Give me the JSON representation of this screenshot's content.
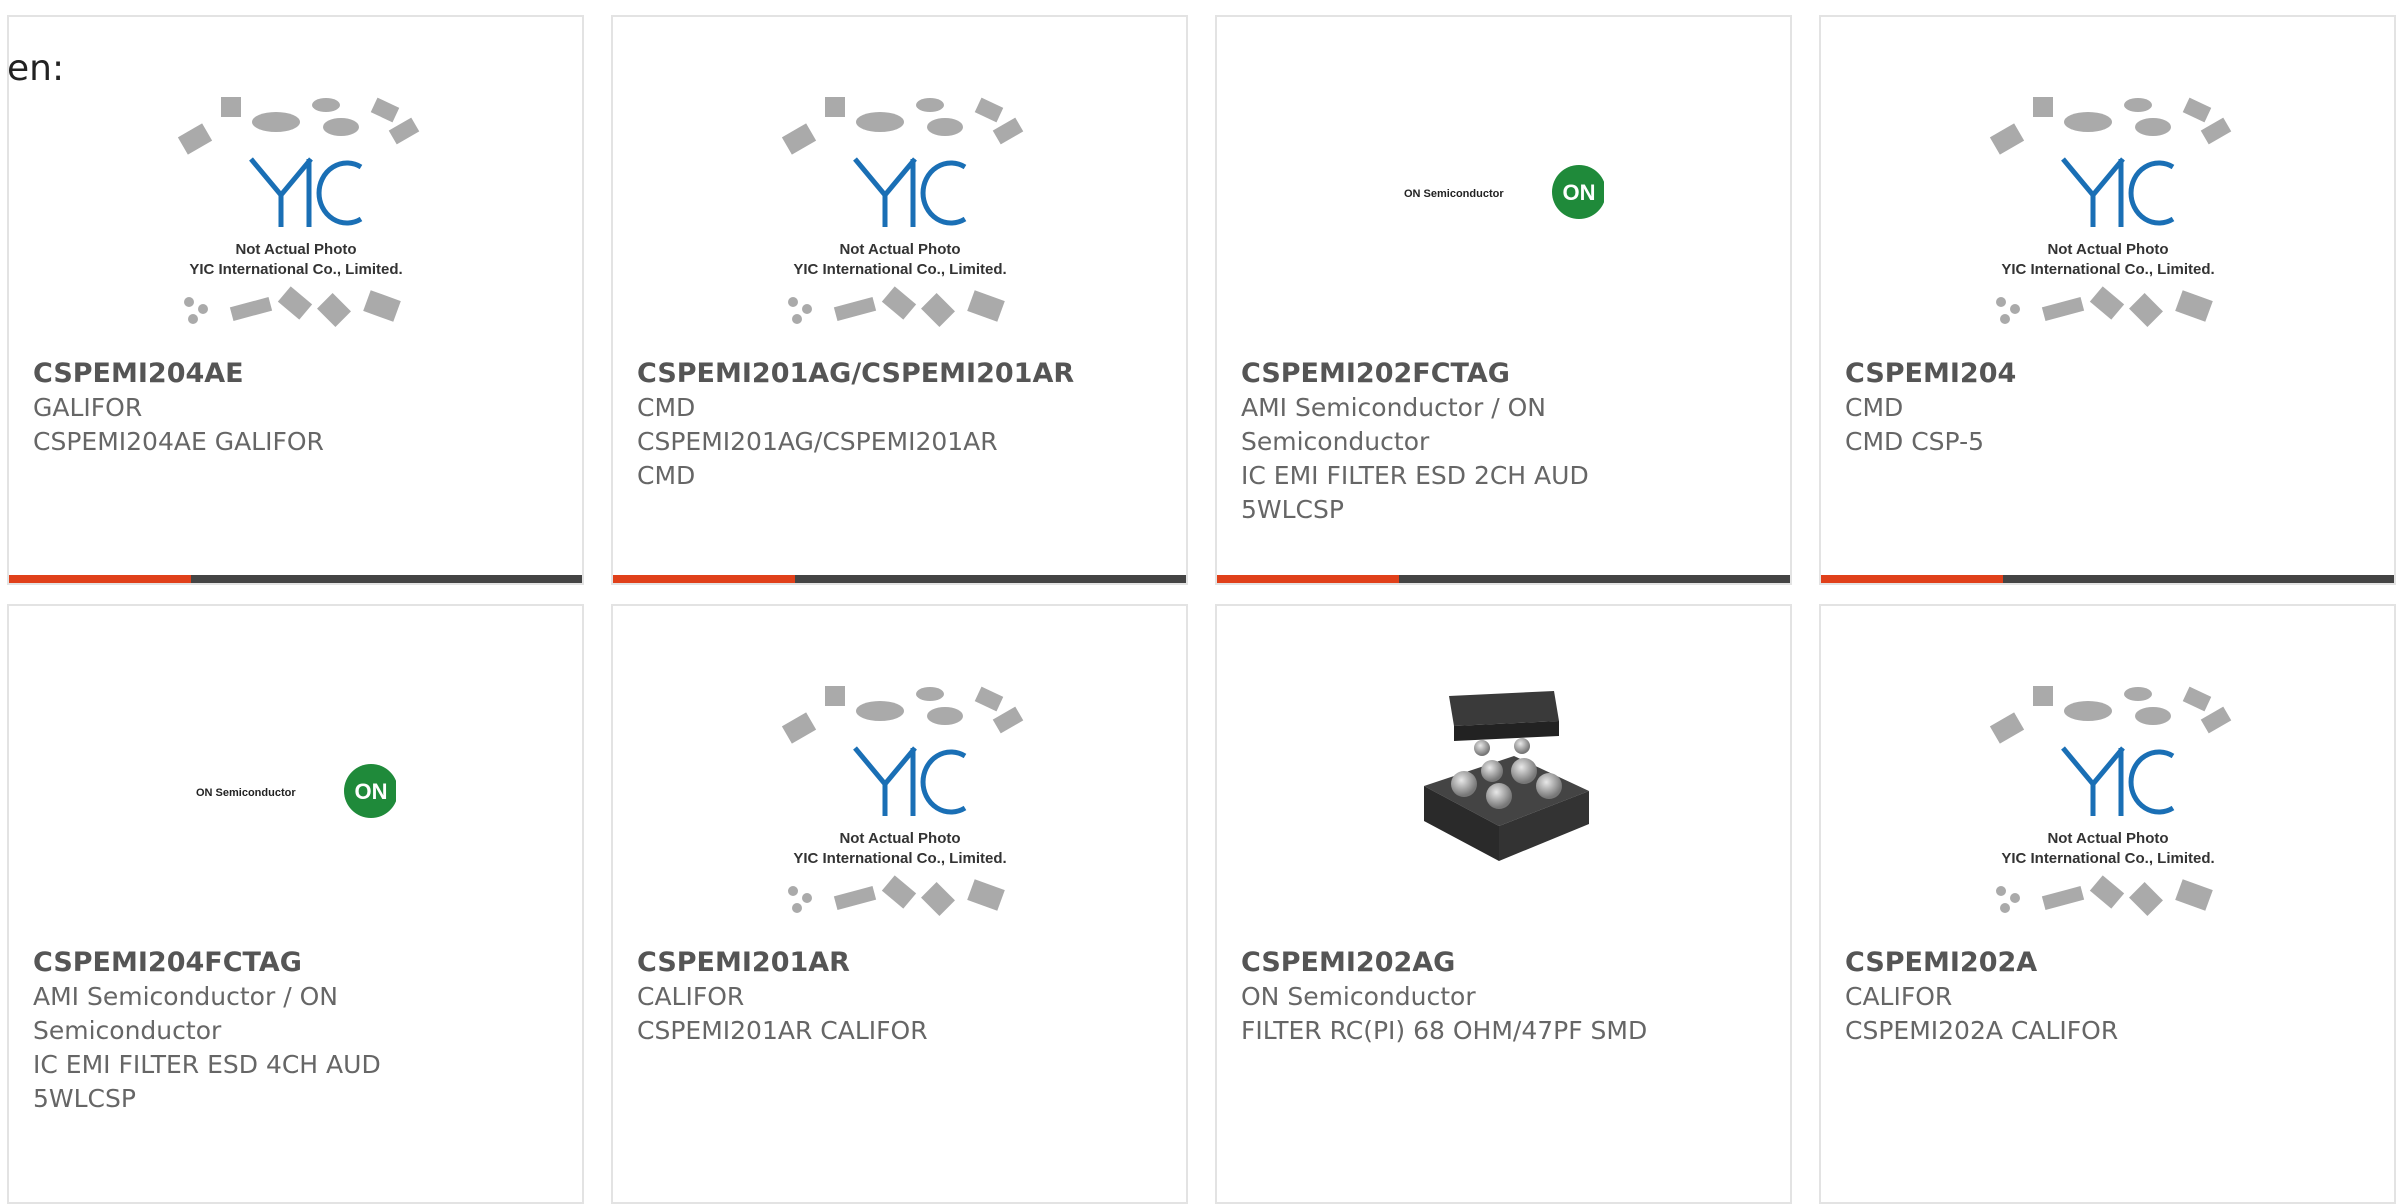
{
  "page_fragment": "en:",
  "cards": [
    {
      "part": "CSPEMI204AE",
      "lines": [
        "GALIFOR",
        "CSPEMI204AE GALIFOR"
      ],
      "image": "yic-not-actual-photo",
      "image_caption": [
        "Not Actual Photo",
        "YIC International Co., Limited."
      ]
    },
    {
      "part": "CSPEMI201AG/CSPEMI201AR",
      "lines": [
        "CMD",
        "CSPEMI201AG/CSPEMI201AR",
        "CMD"
      ],
      "image": "yic-not-actual-photo",
      "image_caption": [
        "Not Actual Photo",
        "YIC International Co., Limited."
      ]
    },
    {
      "part": "CSPEMI202FCTAG",
      "lines": [
        "AMI Semiconductor / ON",
        "Semiconductor",
        "IC EMI FILTER ESD 2CH AUD",
        "5WLCSP"
      ],
      "image": "on-semiconductor-logo",
      "logo_text": [
        "ON Semiconductor",
        "ON"
      ]
    },
    {
      "part": "CSPEMI204",
      "lines": [
        "CMD",
        "CMD CSP-5"
      ],
      "image": "yic-not-actual-photo",
      "image_caption": [
        "Not Actual Photo",
        "YIC International Co., Limited."
      ]
    },
    {
      "part": "CSPEMI204FCTAG",
      "lines": [
        "AMI Semiconductor / ON",
        "Semiconductor",
        "IC EMI FILTER ESD 4CH AUD",
        "5WLCSP"
      ],
      "image": "on-semiconductor-logo",
      "logo_text": [
        "ON Semiconductor",
        "ON"
      ]
    },
    {
      "part": "CSPEMI201AR",
      "lines": [
        "CALIFOR",
        "CSPEMI201AR CALIFOR"
      ],
      "image": "yic-not-actual-photo",
      "image_caption": [
        "Not Actual Photo",
        "YIC International Co., Limited."
      ]
    },
    {
      "part": "CSPEMI202AG",
      "lines": [
        "ON Semiconductor",
        "FILTER RC(PI) 68 OHM/47PF SMD"
      ],
      "image": "csp-chip-photo"
    },
    {
      "part": "CSPEMI202A",
      "lines": [
        "CALIFOR",
        "CSPEMI202A CALIFOR"
      ],
      "image": "yic-not-actual-photo",
      "image_caption": [
        "Not Actual Photo",
        "YIC International Co., Limited."
      ]
    }
  ],
  "colors": {
    "accent": "#e0401a",
    "bar": "#444444",
    "border": "#e3e3e3",
    "on_green": "#1f8a3a",
    "yic_blue": "#1a6fb5"
  }
}
